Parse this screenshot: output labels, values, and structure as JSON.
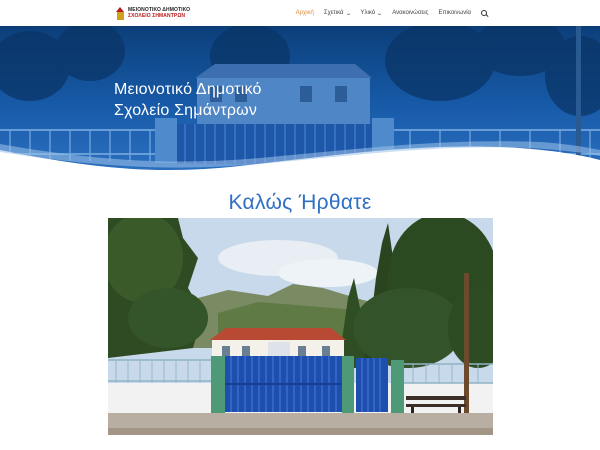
{
  "header": {
    "logo": {
      "line1": "ΜΕΙΟΝΟΤΙΚΟ ΔΗΜΟΤΙΚΟ",
      "line2": "ΣΧΟΛΕΙΟ ΣΗΜΑΝΤΡΩΝ"
    },
    "nav": [
      {
        "label": "Αρχική",
        "active": true,
        "has_dropdown": false
      },
      {
        "label": "Σχετικά",
        "active": false,
        "has_dropdown": true
      },
      {
        "label": "Υλικό",
        "active": false,
        "has_dropdown": true
      },
      {
        "label": "Ανακοινώσεις",
        "active": false,
        "has_dropdown": false
      },
      {
        "label": "Επικοινωνία",
        "active": false,
        "has_dropdown": false
      }
    ],
    "search_icon": "search-icon",
    "dropdown_icon": "chevron-down-icon"
  },
  "hero": {
    "title_line1": "Μειονοτικό Δημοτικό",
    "title_line2": "Σχολείο Σημάντρων"
  },
  "welcome": {
    "heading": "Καλώς Ήρθατε"
  },
  "colors": {
    "accent": "#e08a3c",
    "heading_blue": "#2f6fc4",
    "hero_blue": "#175aa8"
  }
}
